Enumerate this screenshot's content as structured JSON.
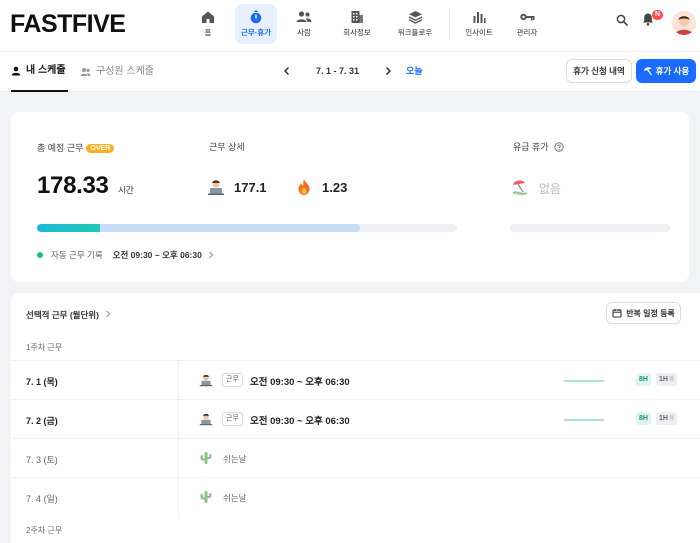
{
  "brand": {
    "logo": "FASTFIVE",
    "accent": "#1a6bff"
  },
  "topnav": {
    "items": [
      {
        "label": "홈",
        "icon": "home-icon"
      },
      {
        "label": "근무·휴가",
        "icon": "stopwatch-icon",
        "active": true
      },
      {
        "label": "사람",
        "icon": "people-icon"
      },
      {
        "label": "회사정보",
        "icon": "building-icon"
      },
      {
        "label": "워크플로우",
        "icon": "layers-icon"
      },
      {
        "label": "인사이트",
        "icon": "bar-chart-icon"
      },
      {
        "label": "관리자",
        "icon": "key-icon"
      }
    ],
    "notification_count": "N"
  },
  "subnav": {
    "tab_mine": "내 스케줄",
    "tab_members": "구성원 스케줄",
    "date_range": "7. 1 - 7. 31",
    "today": "오늘",
    "leave_history_button": "휴가 신청 내역",
    "use_leave_button": "휴가 사용"
  },
  "summary": {
    "total_label": "총 예정 근무",
    "over_badge": "OVER",
    "total_hours": "178.33",
    "total_unit": "시간",
    "detail_label": "근무 상세",
    "detail_work": "177.1",
    "detail_overtime": "1.23",
    "paid_leave_label": "유급 휴가",
    "paid_leave_value": "없음",
    "progress_fill": 0.77,
    "progress_head": 0.15,
    "auto_label": "자동 근무 기록",
    "auto_time": "오전 09:30 ~ 오후 06:30"
  },
  "schedule": {
    "title": "선택적 근무 (월단위)",
    "repeat_button": "반복 일정 등록",
    "week1": "1주차 근무",
    "week2": "2주차 근무",
    "rows": [
      {
        "day": "7. 1 (목)",
        "type": "work",
        "tag": "근무",
        "time": "오전 09:30 ~ 오후 06:30",
        "hours": "8H",
        "break": "1H",
        "break_suffix": "휴"
      },
      {
        "day": "7. 2 (금)",
        "type": "work",
        "tag": "근무",
        "time": "오전 09:30 ~ 오후 06:30",
        "hours": "8H",
        "break": "1H",
        "break_suffix": "휴"
      },
      {
        "day": "7. 3 (토)",
        "type": "off",
        "label": "쉬는날"
      },
      {
        "day": "7. 4 (일)",
        "type": "off",
        "label": "쉬는날"
      }
    ]
  }
}
